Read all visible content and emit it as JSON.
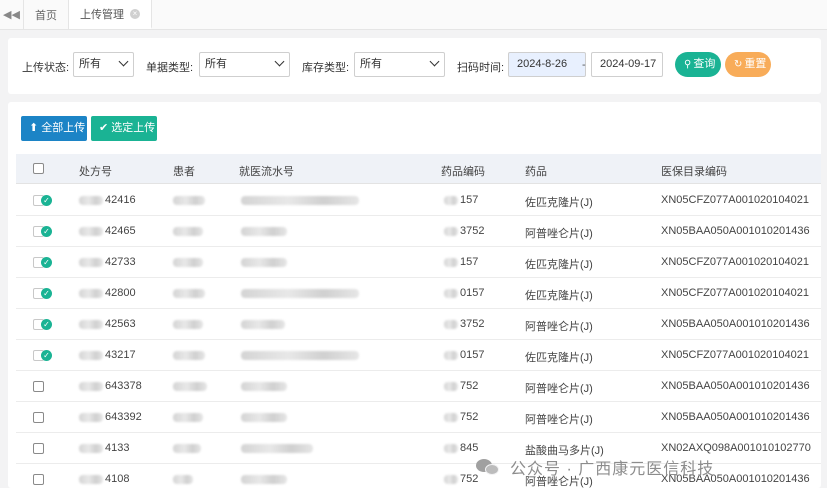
{
  "tabs": {
    "home_label": "首页",
    "active_label": "上传管理"
  },
  "filters": {
    "upload_status_label": "上传状态:",
    "upload_status_value": "所有",
    "doc_type_label": "单据类型:",
    "doc_type_value": "所有",
    "stock_type_label": "库存类型:",
    "stock_type_value": "所有",
    "scan_time_label": "扫码时间:",
    "date_from": "2024-8-26",
    "date_sep": "-",
    "date_to": "2024-09-17",
    "query_label": "查询",
    "reset_label": "重置"
  },
  "actions": {
    "upload_all_label": "全部上传",
    "upload_selected_label": "选定上传"
  },
  "table": {
    "headers": {
      "rx_no": "处方号",
      "patient": "患者",
      "visit_no": "就医流水号",
      "drug_code": "药品编码",
      "drug": "药品",
      "catalog_code": "医保目录编码"
    },
    "rows": [
      {
        "uploaded": true,
        "rx_no": "42416",
        "drug_code": "157",
        "drug": "佐匹克隆片(J)",
        "catalog_code": "XN05CFZ077A001020104021"
      },
      {
        "uploaded": true,
        "rx_no": "42465",
        "drug_code": "3752",
        "drug": "阿普唑仑片(J)",
        "catalog_code": "XN05BAA050A001010201436"
      },
      {
        "uploaded": true,
        "rx_no": "42733",
        "drug_code": "157",
        "drug": "佐匹克隆片(J)",
        "catalog_code": "XN05CFZ077A001020104021"
      },
      {
        "uploaded": true,
        "rx_no": "42800",
        "drug_code": "0157",
        "drug": "佐匹克隆片(J)",
        "catalog_code": "XN05CFZ077A001020104021"
      },
      {
        "uploaded": true,
        "rx_no": "42563",
        "drug_code": "3752",
        "drug": "阿普唑仑片(J)",
        "catalog_code": "XN05BAA050A001010201436"
      },
      {
        "uploaded": true,
        "rx_no": "43217",
        "drug_code": "0157",
        "drug": "佐匹克隆片(J)",
        "catalog_code": "XN05CFZ077A001020104021"
      },
      {
        "uploaded": false,
        "rx_no": "643378",
        "drug_code": "752",
        "drug": "阿普唑仑片(J)",
        "catalog_code": "XN05BAA050A001010201436"
      },
      {
        "uploaded": false,
        "rx_no": "643392",
        "drug_code": "752",
        "drug": "阿普唑仑片(J)",
        "catalog_code": "XN05BAA050A001010201436"
      },
      {
        "uploaded": false,
        "rx_no": "4133",
        "drug_code": "845",
        "drug": "盐酸曲马多片(J)",
        "catalog_code": "XN02AXQ098A001010102770"
      },
      {
        "uploaded": false,
        "rx_no": "4108",
        "drug_code": "752",
        "drug": "阿普唑仑片(J)",
        "catalog_code": "XN05BAA050A001010201436"
      }
    ]
  },
  "watermark": {
    "text": "公众号 · 广西康元医信科技"
  },
  "colors": {
    "primary": "#1c84c6",
    "success": "#1ab394",
    "warning": "#f8ac59",
    "header_bg": "#eff2f7"
  }
}
